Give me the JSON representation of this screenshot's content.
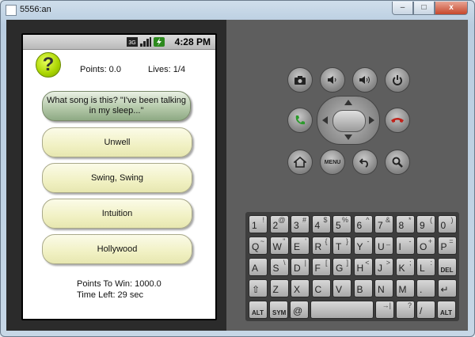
{
  "window": {
    "title": "5556:an",
    "min": "–",
    "max": "□",
    "close": "x"
  },
  "status": {
    "time": "4:28 PM",
    "net": "3G"
  },
  "game": {
    "points": "Points: 0.0",
    "lives": "Lives: 1/4",
    "question": "What song is this? \"I've been talking in my sleep...\"",
    "answers": [
      "Unwell",
      "Swing, Swing",
      "Intuition",
      "Hollywood"
    ],
    "points_to_win": "Points To Win: 1000.0",
    "time_left": "Time Left: 29 sec",
    "icon_glyph": "?"
  },
  "buttons": {
    "menu": "MENU"
  },
  "keyboard": {
    "rows": [
      [
        {
          "m": "1",
          "s": "!"
        },
        {
          "m": "2",
          "s": "@"
        },
        {
          "m": "3",
          "s": "#"
        },
        {
          "m": "4",
          "s": "$"
        },
        {
          "m": "5",
          "s": "%"
        },
        {
          "m": "6",
          "s": "^"
        },
        {
          "m": "7",
          "s": "&"
        },
        {
          "m": "8",
          "s": "*"
        },
        {
          "m": "9",
          "s": "("
        },
        {
          "m": "0",
          "s": ")"
        }
      ],
      [
        {
          "m": "Q",
          "s": "~"
        },
        {
          "m": "W",
          "s": "\""
        },
        {
          "m": "E",
          "s": "'"
        },
        {
          "m": "R",
          "s": "{"
        },
        {
          "m": "T",
          "s": "}"
        },
        {
          "m": "Y",
          "s": "-"
        },
        {
          "m": "U",
          "s": "_"
        },
        {
          "m": "I",
          "s": "-"
        },
        {
          "m": "O",
          "s": "+"
        },
        {
          "m": "P",
          "s": "="
        }
      ],
      [
        {
          "m": "A",
          "s": ""
        },
        {
          "m": "S",
          "s": "\\"
        },
        {
          "m": "D",
          "s": "|"
        },
        {
          "m": "F",
          "s": "["
        },
        {
          "m": "G",
          "s": "]"
        },
        {
          "m": "H",
          "s": "<"
        },
        {
          "m": "J",
          "s": ">"
        },
        {
          "m": "K",
          "s": ";"
        },
        {
          "m": "L",
          "s": ":"
        },
        {
          "m": "DEL",
          "s": ""
        }
      ],
      [
        {
          "m": "⇧",
          "s": ""
        },
        {
          "m": "Z",
          "s": ""
        },
        {
          "m": "X",
          "s": ""
        },
        {
          "m": "C",
          "s": ""
        },
        {
          "m": "V",
          "s": ""
        },
        {
          "m": "B",
          "s": ""
        },
        {
          "m": "N",
          "s": ""
        },
        {
          "m": "M",
          "s": ""
        },
        {
          "m": ".",
          "s": ""
        },
        {
          "m": "↵",
          "s": ""
        }
      ],
      [
        {
          "m": "ALT",
          "s": ""
        },
        {
          "m": "SYM",
          "s": ""
        },
        {
          "m": "@",
          "s": ""
        },
        {
          "m": "",
          "s": ""
        },
        {
          "m": "",
          "s": "→|"
        },
        {
          "m": "",
          "s": "?"
        },
        {
          "m": "/",
          "s": ""
        },
        {
          "m": "ALT",
          "s": ""
        }
      ]
    ]
  }
}
